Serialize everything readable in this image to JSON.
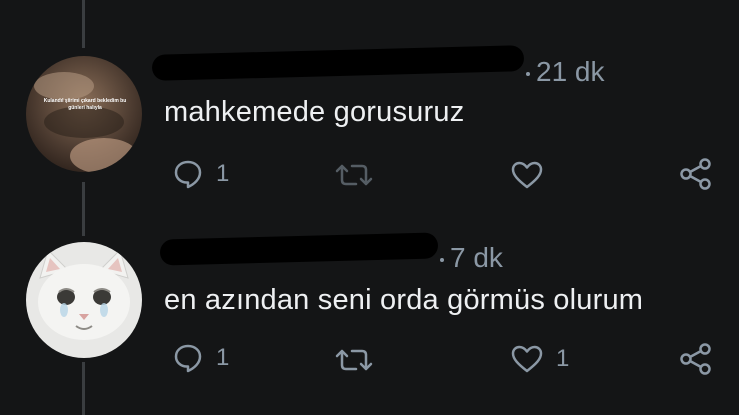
{
  "replies": [
    {
      "time": "21 dk",
      "text": "mahkemede gorusuruz",
      "avatar_caption": "Kulandıl şiirimi çıkard bekledim bu günleri halıyla",
      "counts": {
        "reply": "1",
        "retweet": "",
        "like": ""
      }
    },
    {
      "time": "7 dk",
      "text": "en azından seni orda görmüs olurum",
      "counts": {
        "reply": "1",
        "retweet": "",
        "like": "1"
      }
    }
  ],
  "icons": {
    "reply": "reply-bubble-icon",
    "retweet": "retweet-icon",
    "like": "heart-icon",
    "share": "share-icon"
  },
  "colors": {
    "background": "#141516",
    "text": "#eef0f2",
    "muted": "#8b98a5"
  }
}
